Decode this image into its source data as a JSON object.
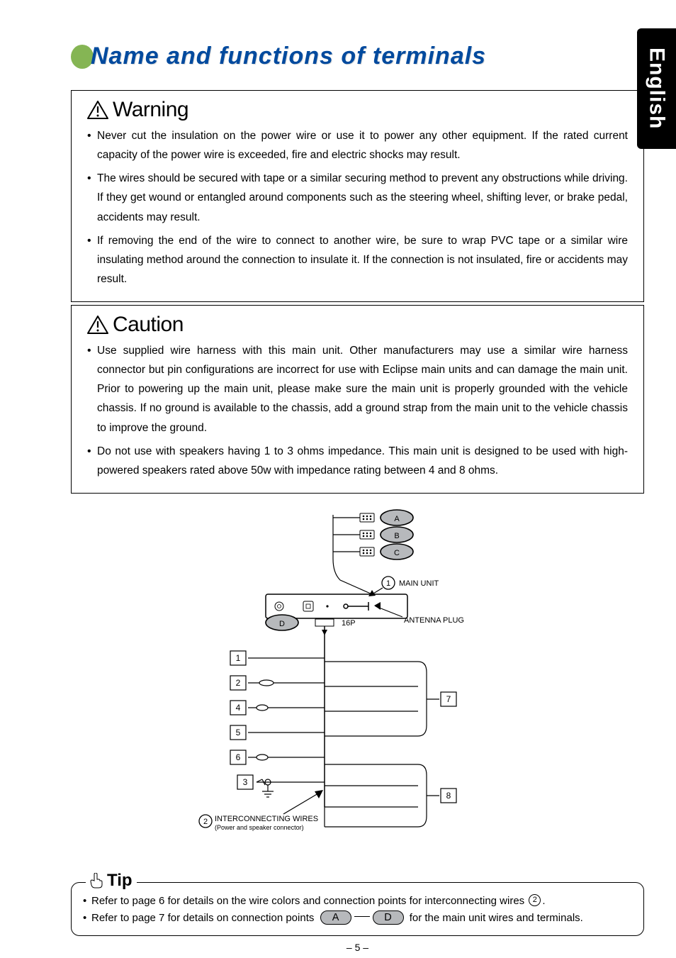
{
  "side_tab": "English",
  "title": "Name and functions of terminals",
  "warning": {
    "heading": "Warning",
    "items": [
      "Never cut the insulation on the power wire or use it to power any other equipment. If the rated current capacity of the power wire is exceeded, fire and electric shocks may result.",
      "The wires should be secured with tape or a similar securing method to prevent any obstructions while driving. If they get wound or entangled around components such as the steering wheel, shifting lever, or brake pedal, accidents may result.",
      "If removing the end of the wire to connect to another wire, be sure to wrap PVC tape or a similar wire insulating method around the connection to insulate it. If the connection is not insulated, fire or accidents may result."
    ]
  },
  "caution": {
    "heading": "Caution",
    "items": [
      "Use supplied wire harness with this main unit.  Other manufacturers may use a similar wire harness connector but pin configurations are incorrect for use with Eclipse main units and can damage the main unit.  Prior to powering up the main unit, please make sure the main unit is properly grounded with the vehicle chassis.  If no ground is available to the chassis, add a ground strap from the main unit to the vehicle chassis to improve the ground.",
      "Do not use with speakers having 1 to 3 ohms impedance.  This main unit is designed to be used with high-powered speakers rated above 50w with impedance rating between 4 and 8 ohms."
    ]
  },
  "diagram": {
    "ovals": {
      "A": "A",
      "B": "B",
      "C": "C",
      "D": "D"
    },
    "circ1": "1",
    "circ2": "2",
    "main_unit": "MAIN UNIT",
    "antenna_plug": "ANTENNA PLUG",
    "p16": "16P",
    "inter_l1": "INTERCONNECTING WIRES",
    "inter_l2": "(Power and speaker connector)",
    "box1": "1",
    "box2": "2",
    "box3": "3",
    "box4": "4",
    "box5": "5",
    "box6": "6",
    "box7": "7",
    "box8": "8"
  },
  "tip": {
    "heading": "Tip",
    "line1_a": "Refer to page 6 for details on the wire colors and connection points for interconnecting wires ",
    "line1_b": ".",
    "circ2": "2",
    "line2_a": "Refer to page 7 for details on connection points ",
    "line2_b": " for the main unit wires and terminals.",
    "ovalA": "A",
    "ovalD": "D"
  },
  "page_number": "– 5 –"
}
